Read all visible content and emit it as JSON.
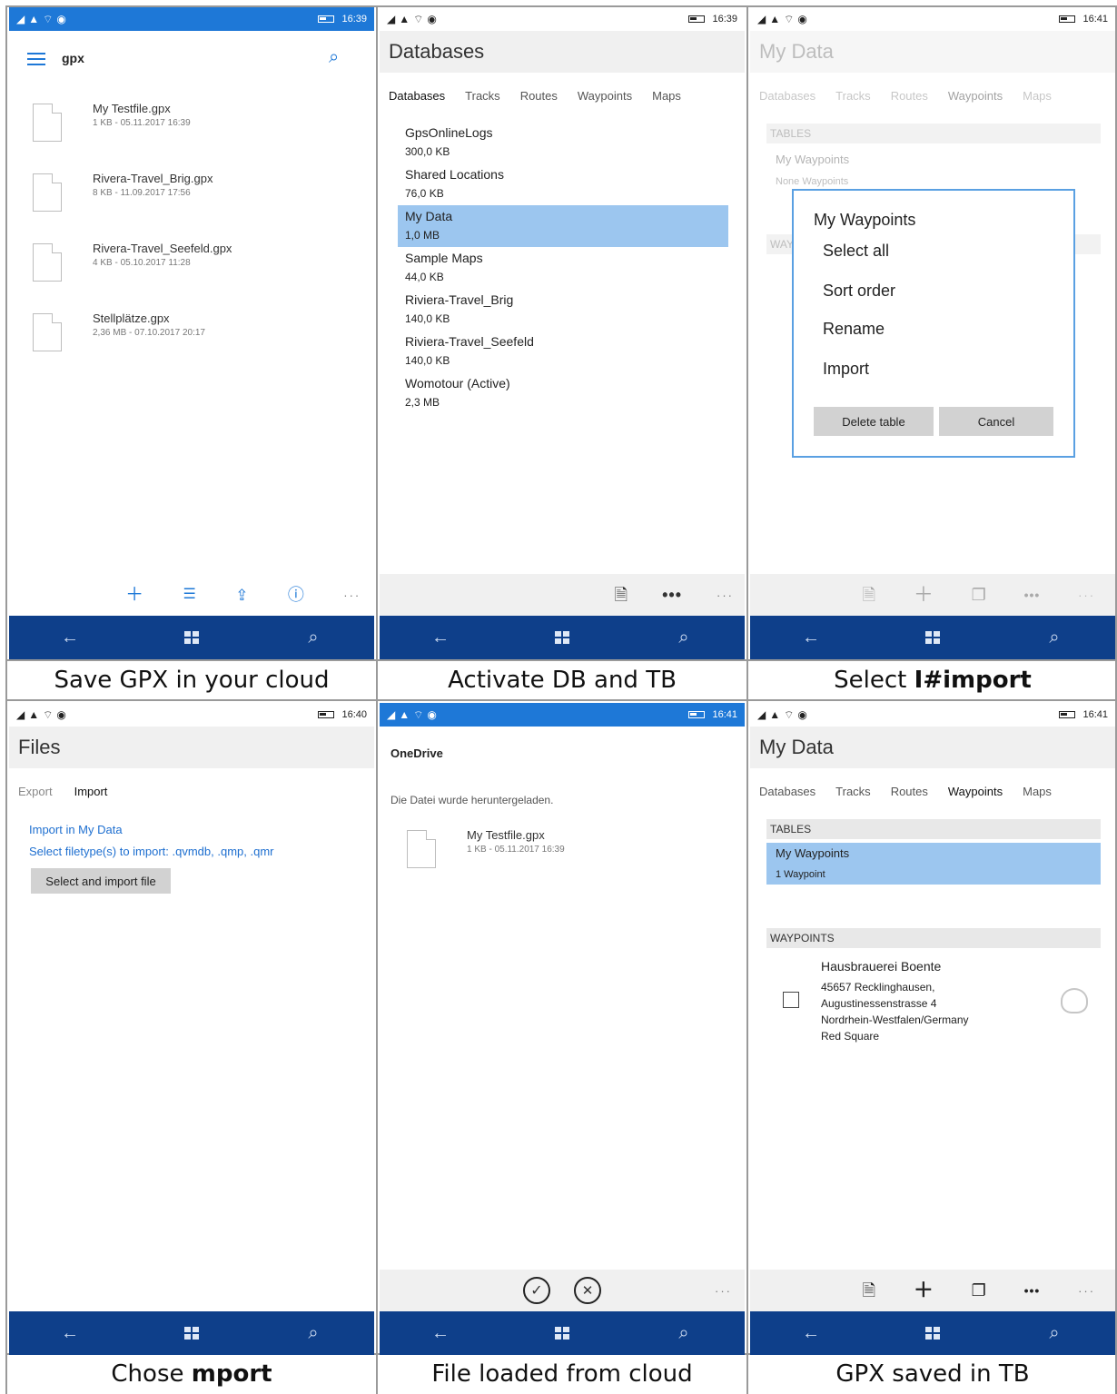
{
  "status": {
    "p1_time": "16:39",
    "p2_time": "16:39",
    "p3_time": "16:41",
    "p4_time": "16:40",
    "p5_time": "16:41",
    "p6_time": "16:41"
  },
  "captions": {
    "p1": "Save GPX in your cloud",
    "p2": "Activate DB and TB",
    "p3_prefix": "Select ",
    "p3_bold": "I#import",
    "p4_prefix": "Chose ",
    "p4_bold": "mport",
    "p5": "File loaded from cloud",
    "p6": "GPX saved in TB"
  },
  "panel1": {
    "folder": "gpx",
    "files": [
      {
        "name": "My Testfile.gpx",
        "meta": "1 KB - 05.11.2017 16:39"
      },
      {
        "name": "Rivera-Travel_Brig.gpx",
        "meta": "8 KB - 11.09.2017 17:56"
      },
      {
        "name": "Rivera-Travel_Seefeld.gpx",
        "meta": "4 KB - 05.10.2017 11:28"
      },
      {
        "name": "Stellplätze.gpx",
        "meta": "2,36 MB - 07.10.2017 20:17"
      }
    ]
  },
  "panel2": {
    "title": "Databases",
    "tabs": [
      "Databases",
      "Tracks",
      "Routes",
      "Waypoints",
      "Maps"
    ],
    "items": [
      {
        "name": "GpsOnlineLogs",
        "size": "300,0 KB"
      },
      {
        "name": "Shared Locations",
        "size": "76,0 KB"
      },
      {
        "name": "My Data",
        "size": "1,0 MB"
      },
      {
        "name": "Sample Maps",
        "size": "44,0 KB"
      },
      {
        "name": "Riviera-Travel_Brig",
        "size": "140,0 KB"
      },
      {
        "name": "Riviera-Travel_Seefeld",
        "size": "140,0 KB"
      },
      {
        "name": "Womotour (Active)",
        "size": "2,3 MB"
      }
    ]
  },
  "panel3": {
    "title": "My Data",
    "tabs": [
      "Databases",
      "Tracks",
      "Routes",
      "Waypoints",
      "Maps"
    ],
    "tables_header": "TABLES",
    "table_name": "My Waypoints",
    "table_sub": "None Waypoints",
    "waypoints_header_partial": "WAY",
    "menu_title": "My Waypoints",
    "menu_items": [
      "Select all",
      "Sort order",
      "Rename",
      "Import"
    ],
    "btn_delete": "Delete table",
    "btn_cancel": "Cancel"
  },
  "panel4": {
    "title": "Files",
    "tabs": [
      "Export",
      "Import"
    ],
    "link1": "Import in My Data",
    "link2": "Select filetype(s) to import: .qvmdb, .qmp, .qmr",
    "button": "Select and import file"
  },
  "panel5": {
    "title": "OneDrive",
    "message": "Die Datei wurde heruntergeladen.",
    "file_name": "My Testfile.gpx",
    "file_meta": "1 KB - 05.11.2017 16:39"
  },
  "panel6": {
    "title": "My Data",
    "tabs": [
      "Databases",
      "Tracks",
      "Routes",
      "Waypoints",
      "Maps"
    ],
    "tables_header": "TABLES",
    "table_name": "My Waypoints",
    "table_sub": "1 Waypoint",
    "waypoints_header": "WAYPOINTS",
    "wp_name": "Hausbrauerei Boente",
    "wp_lines": [
      "45657 Recklinghausen,",
      "Augustinessenstrasse 4",
      "Nordrhein-Westfalen/Germany",
      "Red Square"
    ]
  },
  "colors": {
    "accent_blue": "#1e78d7",
    "nav_bar": "#0e3f8a",
    "selection": "#9cc6ef"
  }
}
